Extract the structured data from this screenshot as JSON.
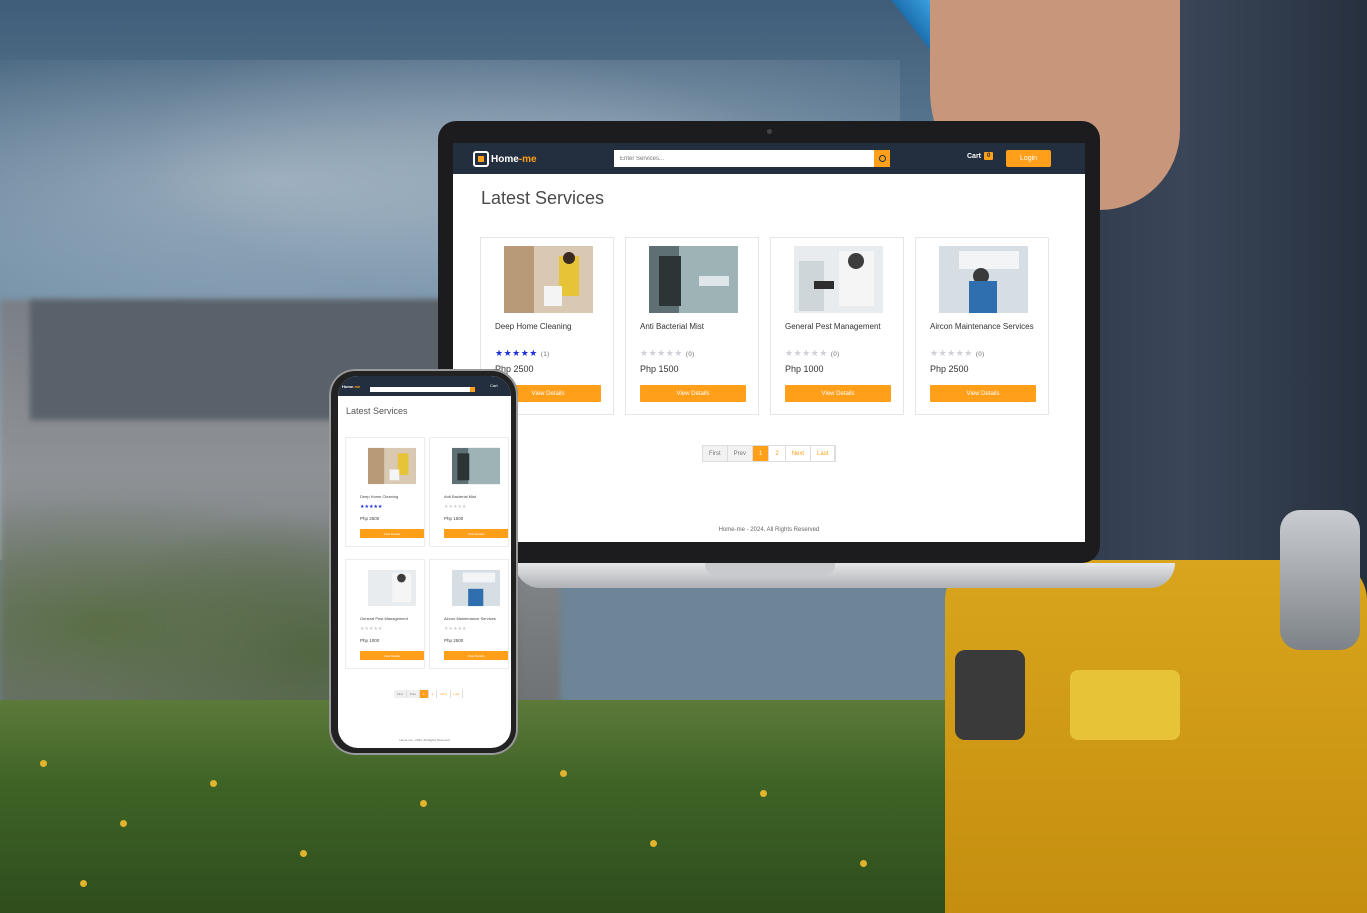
{
  "brand": {
    "name_main": "Home",
    "name_accent": "-me",
    "icon": "home-toolbox-icon"
  },
  "colors": {
    "accent": "#ff9f1a",
    "navbar": "#232f3e",
    "star_filled": "#1f2fd6",
    "star_empty": "#cdd0d6"
  },
  "search": {
    "placeholder": "Enter Services...",
    "icon": "search-icon"
  },
  "nav": {
    "cart_label": "Cart",
    "cart_count": "0",
    "login_label": "Login"
  },
  "page": {
    "heading": "Latest Services"
  },
  "services": [
    {
      "title": "Deep Home Cleaning",
      "rating": 5,
      "reviews": "(1)",
      "price": "Php 2500",
      "button": "View Details",
      "image": "cleaning-photo"
    },
    {
      "title": "Anti Bacterial Mist",
      "rating": 0,
      "reviews": "(0)",
      "price": "Php 1500",
      "button": "View Details",
      "image": "disinfect-photo"
    },
    {
      "title": "General Pest Management",
      "rating": 0,
      "reviews": "(0)",
      "price": "Php 1000",
      "button": "View Details",
      "image": "pest-control-photo"
    },
    {
      "title": "Aircon Maintenance Services",
      "rating": 0,
      "reviews": "(0)",
      "price": "Php 2500",
      "button": "View Details",
      "image": "aircon-photo"
    }
  ],
  "pagination": {
    "first": "First",
    "prev": "Prev",
    "pages": [
      "1",
      "2"
    ],
    "current": "1",
    "next": "Next",
    "last": "Last"
  },
  "footer": {
    "text": "Home-me - 2024, All Rights Reserved"
  }
}
